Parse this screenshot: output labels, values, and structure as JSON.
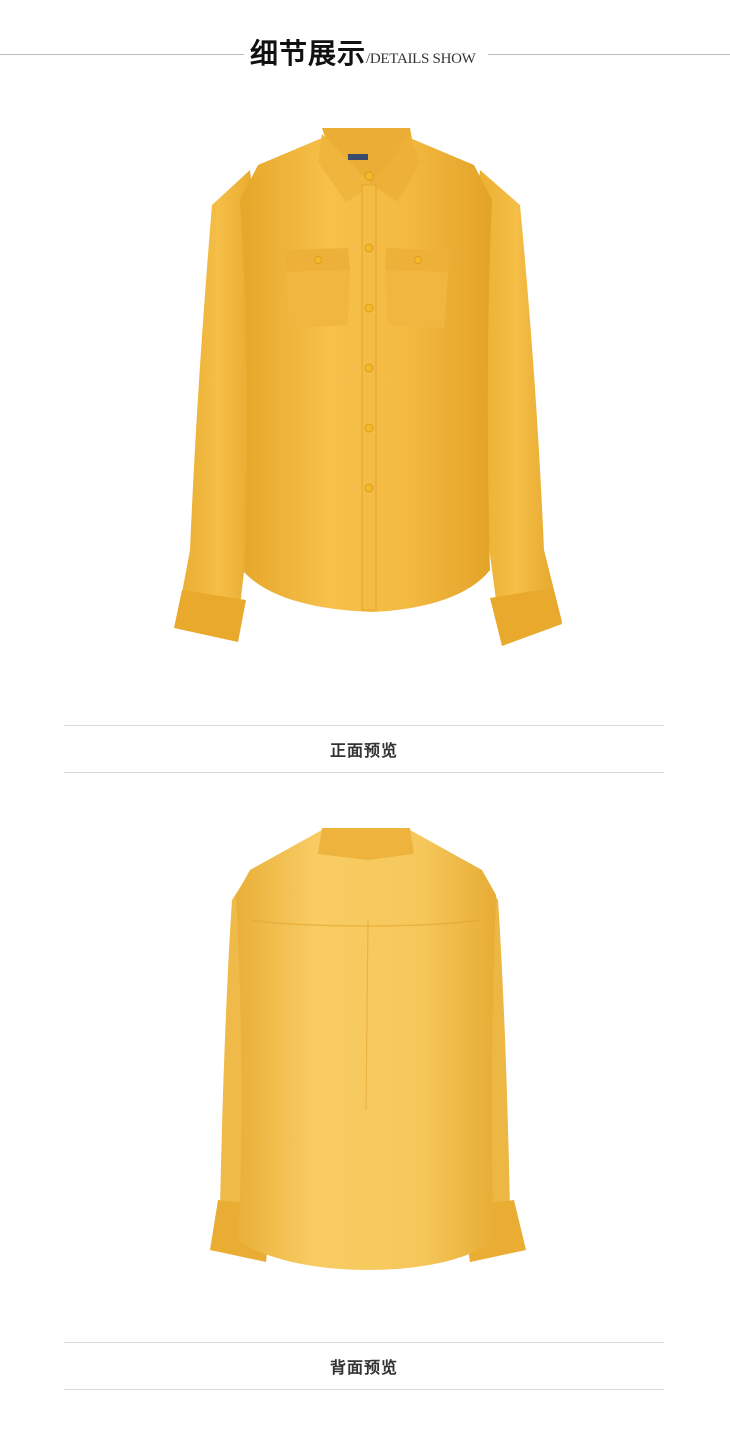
{
  "header": {
    "title_zh": "细节展示",
    "title_en": "/DETAILS SHOW"
  },
  "sections": [
    {
      "caption": "正面预览",
      "view": "front"
    },
    {
      "caption": "背面预览",
      "view": "back"
    }
  ],
  "colors": {
    "shirt_base": "#F2B73A",
    "shirt_shadow": "#E2A326",
    "shirt_highlight": "#F8CC62",
    "button": "#F5B826",
    "rule": "#d8d8d8"
  }
}
